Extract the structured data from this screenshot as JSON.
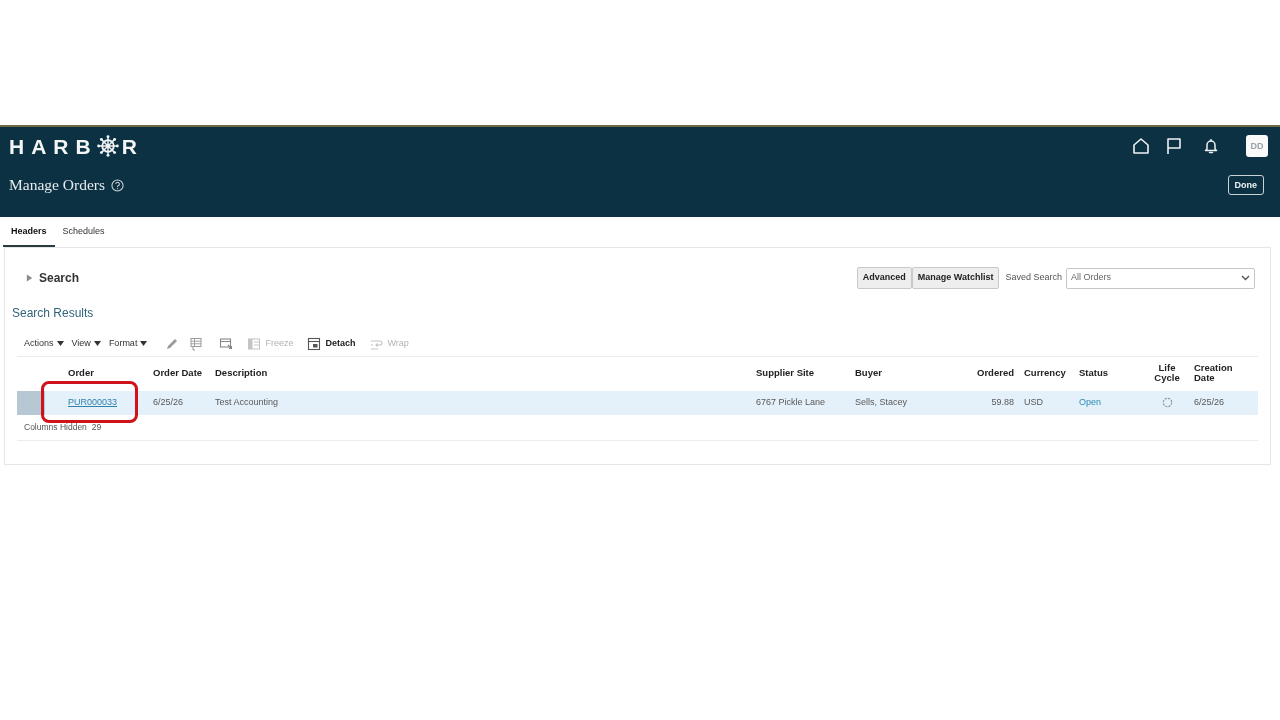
{
  "header": {
    "logo_text_start": "HARB",
    "logo_text_end": "R",
    "avatar": "DD",
    "page_title": "Manage Orders",
    "done_button": "Done"
  },
  "tabs": [
    {
      "label": "Headers",
      "selected": true
    },
    {
      "label": "Schedules",
      "selected": false
    }
  ],
  "search": {
    "label": "Search",
    "expanded": false,
    "buttons": [
      "Advanced",
      "Manage Watchlist"
    ],
    "saved_search_label": "Saved Search",
    "saved_search_value": "All Orders"
  },
  "results": {
    "title": "Search Results",
    "menus": [
      {
        "label": "Actions"
      },
      {
        "label": "View"
      },
      {
        "label": "Format"
      }
    ],
    "actions": [
      {
        "label": "Freeze",
        "disabled": true
      },
      {
        "label": "Detach",
        "disabled": false
      },
      {
        "label": "Wrap",
        "disabled": true
      }
    ],
    "table": {
      "columns": [
        {
          "label": "Order",
          "kind": "text"
        },
        {
          "label": "Order Date",
          "kind": "text"
        },
        {
          "label": "Description",
          "kind": "text"
        },
        {
          "label": "Supplier Site",
          "kind": "text"
        },
        {
          "label": "Buyer",
          "kind": "text"
        },
        {
          "label": "Ordered",
          "kind": "number"
        },
        {
          "label": "Currency",
          "kind": "text"
        },
        {
          "label": "Status",
          "kind": "text"
        },
        {
          "label": "Life Cycle",
          "kind": "icon"
        },
        {
          "label": "Creation Date",
          "kind": "text"
        }
      ],
      "rows": [
        {
          "selected": true,
          "order_highlighted": true,
          "cells": [
            {
              "kind": "link",
              "text": "PUR000033"
            },
            {
              "kind": "text",
              "text": "6/25/26"
            },
            {
              "kind": "text",
              "text": "Test Accounting"
            },
            {
              "kind": "text",
              "text": "6767 Pickle Lane"
            },
            {
              "kind": "text",
              "text": "Sells, Stacey"
            },
            {
              "kind": "number",
              "text": "59.88"
            },
            {
              "kind": "text",
              "text": "USD"
            },
            {
              "kind": "status",
              "text": "Open"
            },
            {
              "kind": "icon"
            },
            {
              "kind": "text",
              "text": "6/25/26"
            }
          ]
        }
      ]
    },
    "hidden_columns": {
      "label": "Columns Hidden",
      "count": "29"
    }
  }
}
